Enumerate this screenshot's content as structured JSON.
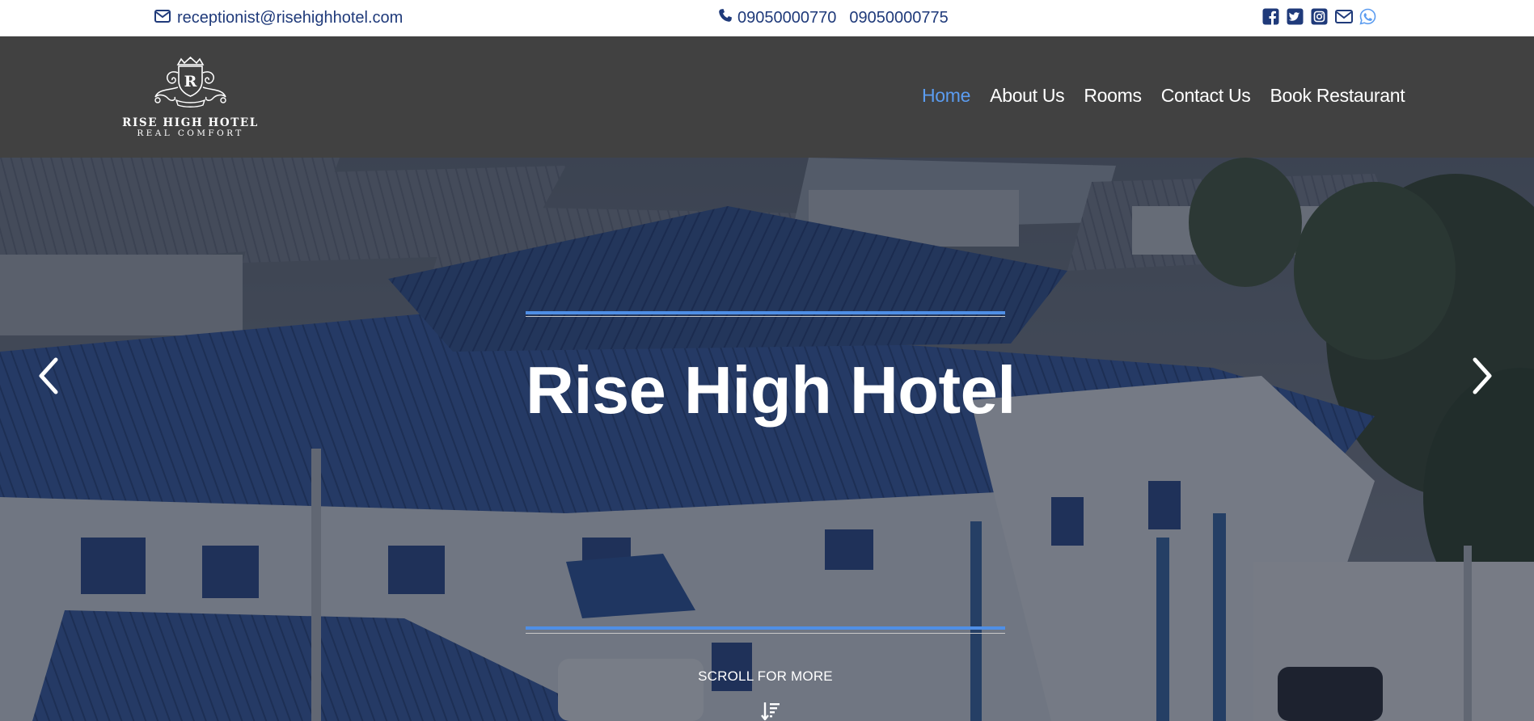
{
  "topbar": {
    "email": "receptionist@risehighhotel.com",
    "phone_1": "09050000770",
    "phone_2": "09050000775",
    "icons": [
      "envelope-icon",
      "phone-icon",
      "facebook-icon",
      "twitter-icon",
      "instagram-icon",
      "mail-icon",
      "whatsapp-icon"
    ],
    "icon_color": "#1f3a7a",
    "whatsapp_color": "#5b9cf0"
  },
  "logo": {
    "monogram": "R",
    "brand": "RISE HIGH HOTEL",
    "tagline": "REAL COMFORT"
  },
  "nav": {
    "items": [
      {
        "label": "Home",
        "active": true
      },
      {
        "label": "About Us",
        "active": false
      },
      {
        "label": "Rooms",
        "active": false
      },
      {
        "label": "Contact Us",
        "active": false
      },
      {
        "label": "Book Restaurant",
        "active": false
      }
    ],
    "background": "#414141",
    "active_color": "#5b9cf0"
  },
  "hero": {
    "title": "Rise High Hotel",
    "scroll_text": "SCROLL FOR MORE",
    "accent_color": "#4f8fe6",
    "icons": [
      "chevron-left-icon",
      "chevron-right-icon",
      "sort-down-icon"
    ]
  }
}
